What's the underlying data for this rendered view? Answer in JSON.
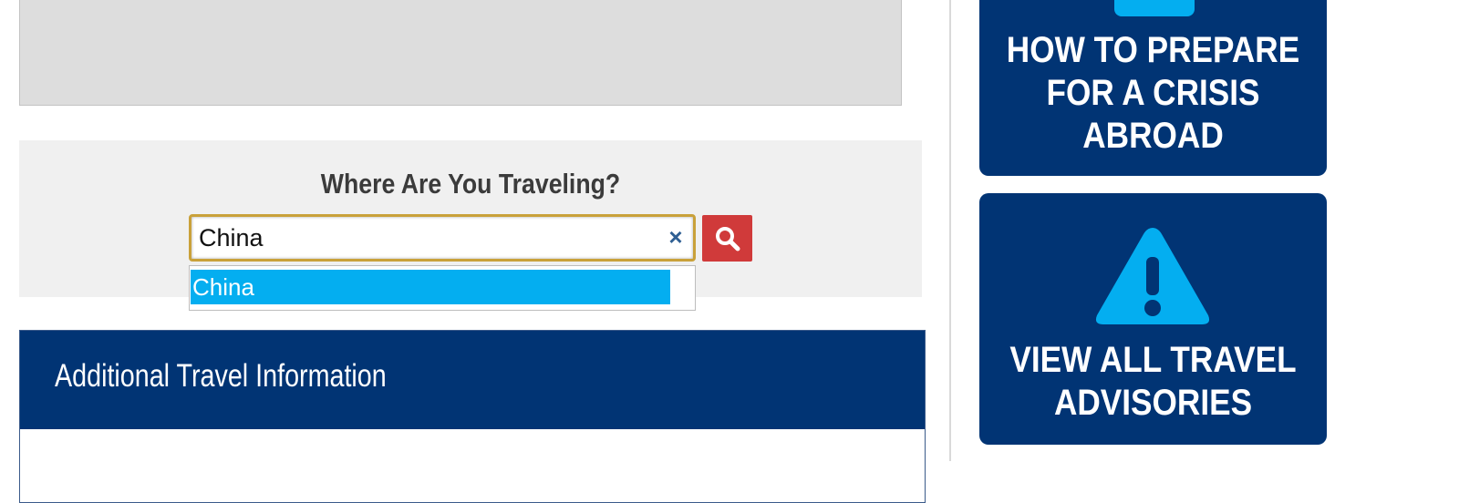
{
  "search": {
    "title": "Where Are You Traveling?",
    "value": "China",
    "clear_icon": "×",
    "suggestions": [
      "China"
    ]
  },
  "info": {
    "header": "Additional Travel Information"
  },
  "tiles": [
    {
      "label": "HOW TO PREPARE FOR A CRISIS ABROAD",
      "lines": [
        "HOW TO PREPARE",
        "FOR A CRISIS",
        "ABROAD"
      ]
    },
    {
      "label": "VIEW ALL TRAVEL ADVISORIES",
      "lines": [
        "VIEW ALL TRAVEL",
        "ADVISORIES"
      ]
    }
  ],
  "colors": {
    "navy": "#013474",
    "accent_blue": "#04aef0",
    "search_red": "#d03a3a",
    "focus_gold": "#c9a13a",
    "panel_gray": "#f0f0f0"
  },
  "icons": {
    "search_button": "magnifier-icon",
    "clear": "close-icon",
    "tile_2": "warning-triangle-icon"
  }
}
